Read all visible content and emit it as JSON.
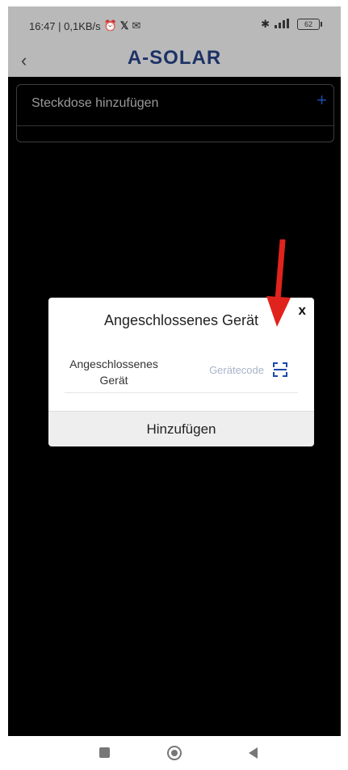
{
  "status_bar": {
    "time_speed": "16:47 | 0,1KB/s",
    "battery": "62"
  },
  "app": {
    "title": "A-SOLAR"
  },
  "card": {
    "label": "Steckdose hinzufügen",
    "plus": "+"
  },
  "dialog": {
    "title": "Angeschlossenes Gerät",
    "close": "x",
    "field_label_line1": "Angeschlossenes",
    "field_label_line2": "Gerät",
    "field_placeholder": "Gerätecode",
    "button_label": "Hinzufügen"
  },
  "colors": {
    "accent_blue": "#1a4ba8",
    "title_navy": "#1c3266",
    "arrow_red": "#e0231c",
    "dim_header": "#b9b9b9"
  },
  "icons": [
    "back-chevron-icon",
    "alarm-icon",
    "x-icon",
    "message-icon",
    "bluetooth-icon",
    "signal-icon",
    "battery-icon",
    "plus-icon",
    "scan-icon",
    "red-arrow-annotation",
    "nav-square-icon",
    "nav-circle-icon",
    "nav-triangle-icon"
  ]
}
